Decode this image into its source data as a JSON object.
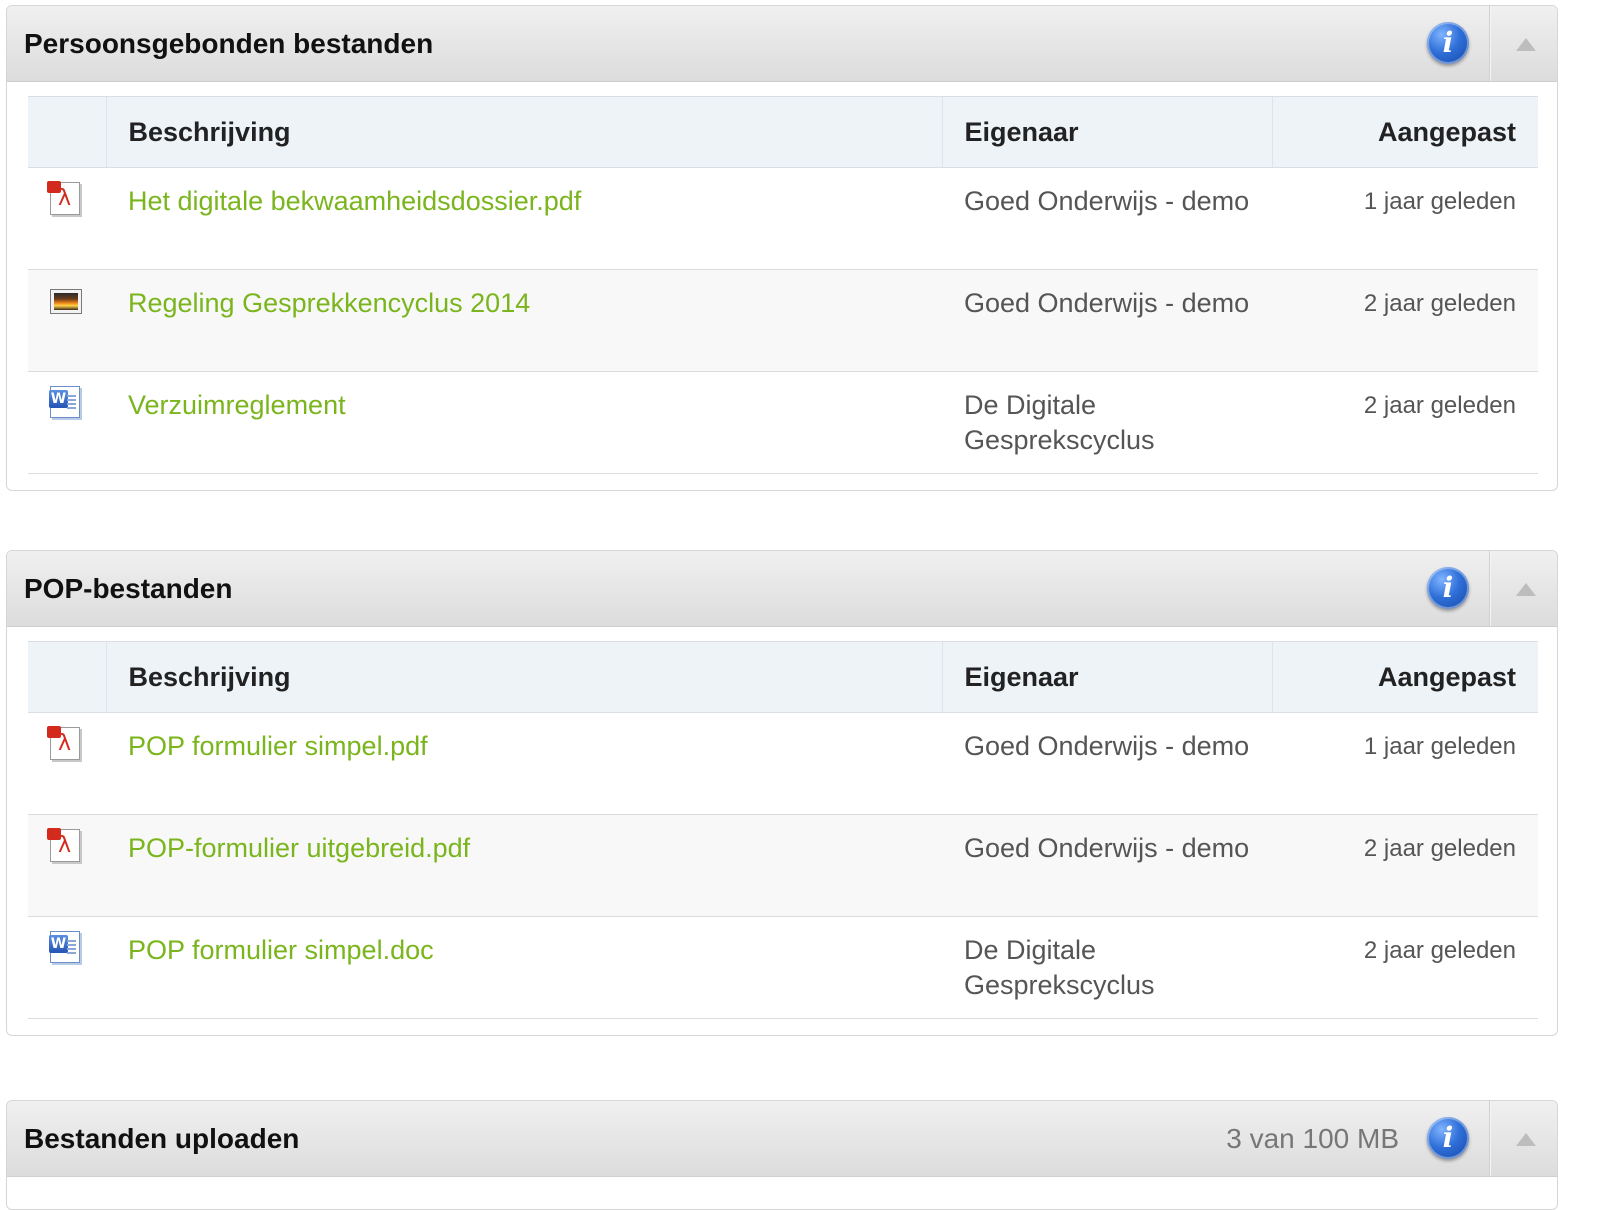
{
  "panels": [
    {
      "title": "Persoonsgebonden bestanden",
      "info_icon": "info-icon",
      "collapse_icon": "chevron-up-icon",
      "columns": {
        "description": "Beschrijving",
        "owner": "Eigenaar",
        "modified": "Aangepast"
      },
      "rows": [
        {
          "icon": "pdf-file-icon",
          "name": "Het digitale bekwaamheidsdossier.pdf",
          "owner": "Goed Onderwijs - demo",
          "modified": "1 jaar geleden"
        },
        {
          "icon": "image-file-icon",
          "name": "Regeling Gesprekkencyclus 2014",
          "owner": "Goed Onderwijs - demo",
          "modified": "2 jaar geleden"
        },
        {
          "icon": "word-file-icon",
          "name": "Verzuimreglement",
          "owner": "De Digitale Gesprekscyclus",
          "modified": "2 jaar geleden"
        }
      ]
    },
    {
      "title": "POP-bestanden",
      "info_icon": "info-icon",
      "collapse_icon": "chevron-up-icon",
      "columns": {
        "description": "Beschrijving",
        "owner": "Eigenaar",
        "modified": "Aangepast"
      },
      "rows": [
        {
          "icon": "pdf-file-icon",
          "name": "POP formulier simpel.pdf",
          "owner": "Goed Onderwijs - demo",
          "modified": "1 jaar geleden"
        },
        {
          "icon": "pdf-file-icon",
          "name": "POP-formulier uitgebreid.pdf",
          "owner": "Goed Onderwijs - demo",
          "modified": "2 jaar geleden"
        },
        {
          "icon": "word-file-icon",
          "name": "POP formulier simpel.doc",
          "owner": "De Digitale Gesprekscyclus",
          "modified": "2 jaar geleden"
        }
      ]
    },
    {
      "title": "Bestanden uploaden",
      "quota": "3 van 100 MB",
      "info_icon": "info-icon",
      "collapse_icon": "chevron-up-icon"
    }
  ],
  "colors": {
    "link": "#7ab51d",
    "header_bg": "#e6e6e6",
    "table_header_bg": "#eef3f8",
    "info_blue": "#2f6fd8"
  }
}
